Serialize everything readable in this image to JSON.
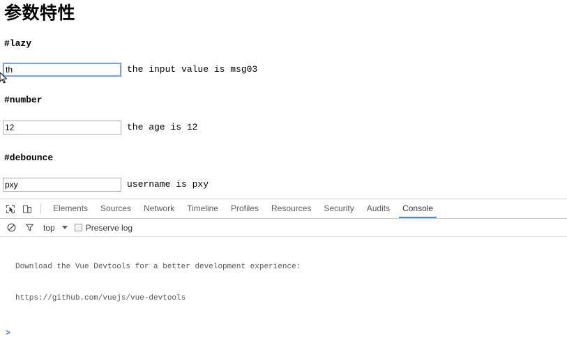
{
  "page": {
    "title": "参数特性",
    "sections": [
      {
        "id": "lazy",
        "heading": "#lazy",
        "input_value": "th",
        "input_placeholder": "",
        "caption": "the input value is msg03",
        "focused": true
      },
      {
        "id": "number",
        "heading": "#number",
        "input_value": "12",
        "input_placeholder": "",
        "caption": "the age is 12",
        "focused": false
      },
      {
        "id": "debounce",
        "heading": "#debounce",
        "input_value": "pxy",
        "input_placeholder": "",
        "caption": "username is pxy",
        "focused": false
      }
    ]
  },
  "devtools": {
    "icons": {
      "inspect": "inspect-element-icon",
      "device": "device-toolbar-icon",
      "clear": "clear-console-icon",
      "filter": "filter-icon"
    },
    "tabs": [
      {
        "label": "Elements",
        "active": false
      },
      {
        "label": "Sources",
        "active": false
      },
      {
        "label": "Network",
        "active": false
      },
      {
        "label": "Timeline",
        "active": false
      },
      {
        "label": "Profiles",
        "active": false
      },
      {
        "label": "Resources",
        "active": false
      },
      {
        "label": "Security",
        "active": false
      },
      {
        "label": "Audits",
        "active": false
      },
      {
        "label": "Console",
        "active": true
      }
    ],
    "active_tab": "Console",
    "console_toolbar": {
      "context": "top",
      "preserve_log_label": "Preserve log",
      "preserve_log_checked": false
    },
    "console": {
      "message_line1": "Download the Vue Devtools for a better development experience:",
      "message_line2": "https://github.com/vuejs/vue-devtools",
      "prompt": ">",
      "input_value": ""
    }
  },
  "colors": {
    "accent": "#4285f4",
    "focus_border": "#7aa3dd",
    "prompt": "#4a7fd4",
    "text": "#000000",
    "muted": "#5a5a5a",
    "border": "#cdcdcd"
  }
}
